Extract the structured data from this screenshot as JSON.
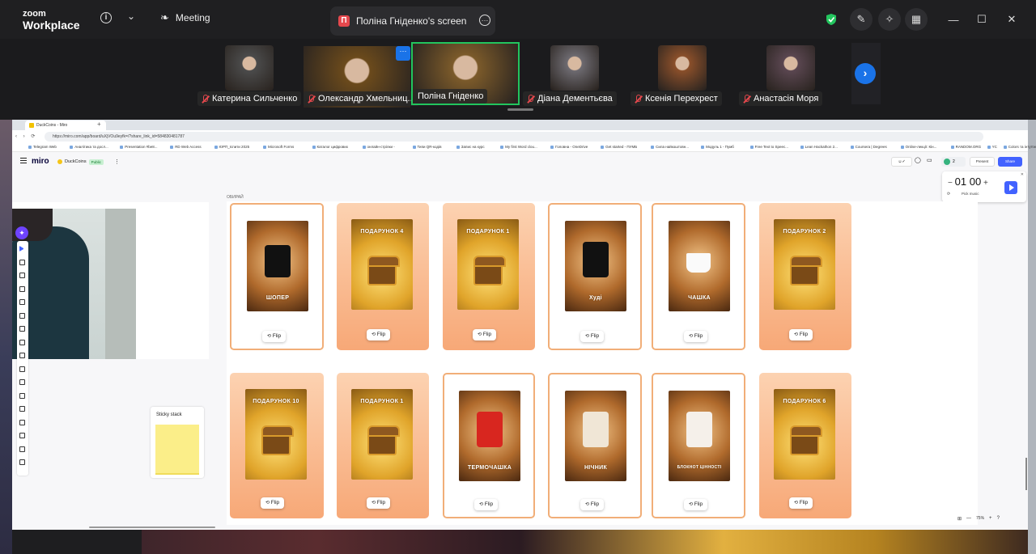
{
  "zoom": {
    "logo_line1": "zoom",
    "logo_line2": "Workplace",
    "meeting_label": "Meeting",
    "share_initial": "П",
    "share_title": "Поліна Гніденко's screen",
    "participants": [
      {
        "name": "Катерина Сильченко",
        "color": "#4b4b4b"
      },
      {
        "name": "Олександр Хмельниц...",
        "color": "#6b4a1c"
      },
      {
        "name": "Поліна Гніденко",
        "color": "#7b5a2a"
      },
      {
        "name": "Діана Дементьєва",
        "color": "#6d6a70"
      },
      {
        "name": "Ксенія Перехрест",
        "color": "#8a4f2a"
      },
      {
        "name": "Анастасія Моря",
        "color": "#5a4650"
      }
    ]
  },
  "browser": {
    "tab_title": "DuckCoins - Miro",
    "url": "https://miro.com/app/board/uXjVOu9eyfk=/?share_link_id=584830481787",
    "bookmarks": [
      "Telegram Web",
      "Аналітика та досл...",
      "Presentation #be8...",
      "RD Web Access",
      "ЮРП_Іспити 2025",
      "Microsoft Forms",
      "Каталог цифрових",
      "онлайн-стрілки -",
      "Типи QR-кодів",
      "Запис на курс",
      "My first Word clou...",
      "Головна - OneDrive",
      "Get started - ПУМБ",
      "Сила найкоштовн...",
      "Модуль 1 - Пумб",
      "Free Text to Speec...",
      "Lean Hackathon 2...",
      "Coursera | Degrees",
      "Online-лекції: Кін...",
      "RANDOM.ORG",
      "YC",
      "Colors та інтуїтив..."
    ]
  },
  "miro": {
    "logo": "miro",
    "board_name": "DuckCoins",
    "public_badge": "Public",
    "collab_count": "2",
    "present": "Present",
    "share": "Share",
    "timer_min": "01",
    "timer_sec": "00",
    "pick_music": "Pick music",
    "frame_title": "ОБИРАЙ",
    "sticky_stack": "Sticky stack",
    "zoom_level": "75%",
    "flip_label": "Flip",
    "cards": [
      {
        "title": "ШОПЕР",
        "art": "bronze",
        "item": "bag"
      },
      {
        "title": "ПОДАРУНОК 4",
        "art": "gold",
        "item": "chest"
      },
      {
        "title": "ПОДАРУНОК 1",
        "art": "gold",
        "item": "chest"
      },
      {
        "title": "Худі",
        "art": "bronze",
        "item": "hoodie"
      },
      {
        "title": "ЧАШКА",
        "art": "bronze",
        "item": "mug"
      },
      {
        "title": "ПОДАРУНОК 2",
        "art": "gold",
        "item": "chest"
      },
      {
        "title": "ПОДАРУНОК 10",
        "art": "gold",
        "item": "chest"
      },
      {
        "title": "ПОДАРУНОК 1",
        "art": "gold",
        "item": "chest"
      },
      {
        "title": "ТЕРМОЧАШКА",
        "art": "bronze",
        "item": "thermo"
      },
      {
        "title": "НІЧНИК",
        "art": "bronze",
        "item": "lamp"
      },
      {
        "title": "БЛОКНОТ ЦІННОСТІ",
        "art": "bronze",
        "item": "notebook"
      },
      {
        "title": "ПОДАРУНОК 6",
        "art": "gold",
        "item": "chest"
      }
    ]
  }
}
